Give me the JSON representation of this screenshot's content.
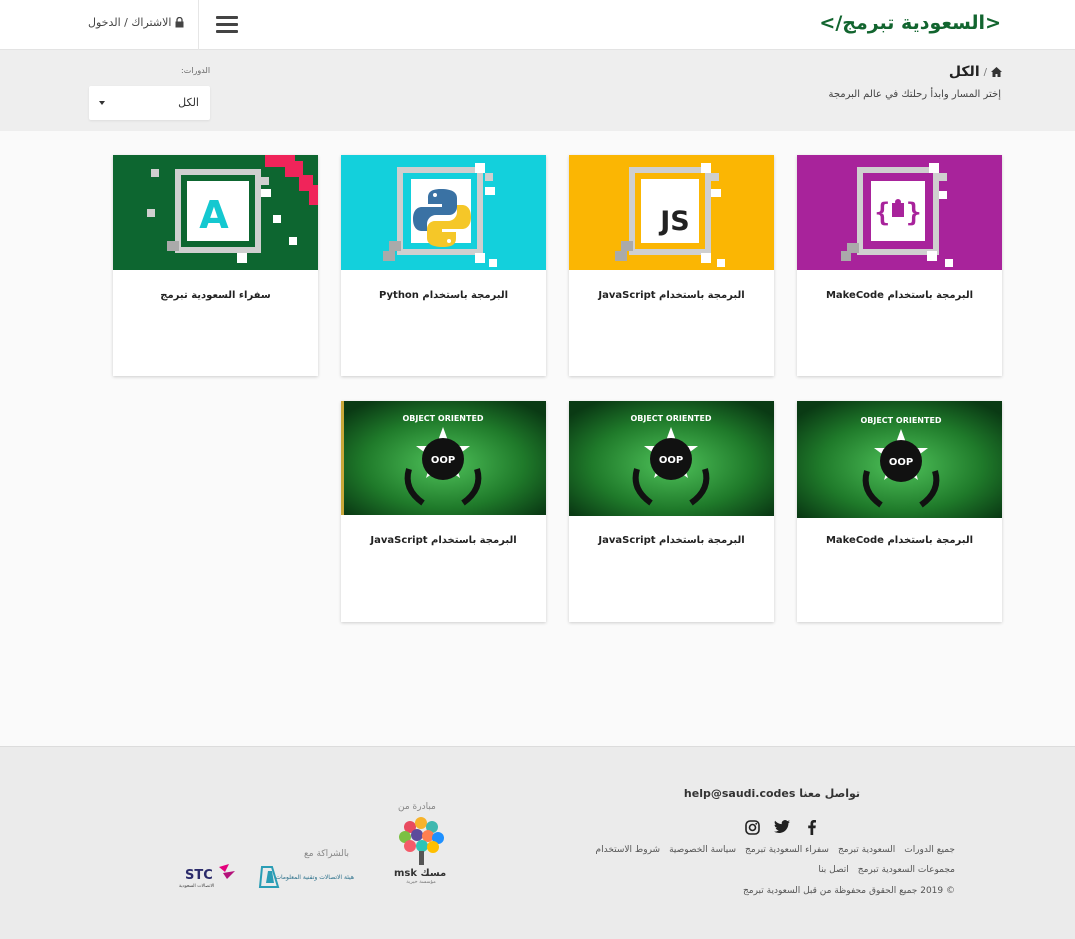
{
  "header": {
    "logo": "</السعودية تبرمج>",
    "login": "الاشتراك / الدخول"
  },
  "band": {
    "title": "الكل",
    "subtitle": "إختر المسار وابدأ رحلتك في عالم البرمجة",
    "filter_label": "الدورات:",
    "filter_value": "الكل"
  },
  "courses": [
    {
      "title": "البرمجة باستخدام MakeCode",
      "thumb_color": "#a8239b",
      "thumb_icon": "puzzle-braces-icon"
    },
    {
      "title": "البرمجة باستخدام JavaScript",
      "thumb_color": "#fbb603",
      "thumb_icon": "js-icon",
      "icon_text": "JS"
    },
    {
      "title": "البرمجة باستخدام Python",
      "thumb_color": "#13d0dc",
      "thumb_icon": "python-icon"
    },
    {
      "title": "سفراء السعودية تبرمج",
      "thumb_color": "#0d6630",
      "thumb_icon": "letter-a-icon",
      "icon_text": "A"
    },
    {
      "title": "البرمجة باستخدام MakeCode",
      "thumb_color": "#1f6e2a",
      "thumb_icon": "oop-badge-icon",
      "badge_text": "OBJECT ORIENTED",
      "badge_inner": "OOP"
    },
    {
      "title": "البرمجة باستخدام JavaScript",
      "thumb_color": "#1f6e2a",
      "thumb_icon": "oop-badge-icon",
      "badge_text": "OBJECT ORIENTED",
      "badge_inner": "OOP"
    },
    {
      "title": "البرمجة باستخدام JavaScript",
      "thumb_color": "#1f6e2a",
      "thumb_icon": "oop-badge-icon",
      "badge_text": "OBJECT ORIENTED",
      "badge_inner": "OOP"
    }
  ],
  "footer": {
    "contact": "تواصل معنا help@saudi.codes",
    "links_row1": [
      "جميع الدورات",
      "السعودية تبرمج",
      "سفراء السعودية تبرمج",
      "سياسة الخصوصية",
      "شروط الاستخدام"
    ],
    "links_row2": [
      "مجموعات السعودية تبرمج",
      "اتصل بنا"
    ],
    "copyright": "© 2019 جميع الحقوق محفوظة من قبل السعودية تبرمج",
    "initiative_label": "مبادرة من",
    "misk_text": "msk مسك",
    "misk_sub": "مؤسسة خيرية",
    "partner_label": "بالشراكة مع",
    "partner1_text": "هيئة الاتصالات وتقنية المعلومات",
    "partner2_text": "STC",
    "partner2_sub": "الاتصالات السعودية"
  }
}
